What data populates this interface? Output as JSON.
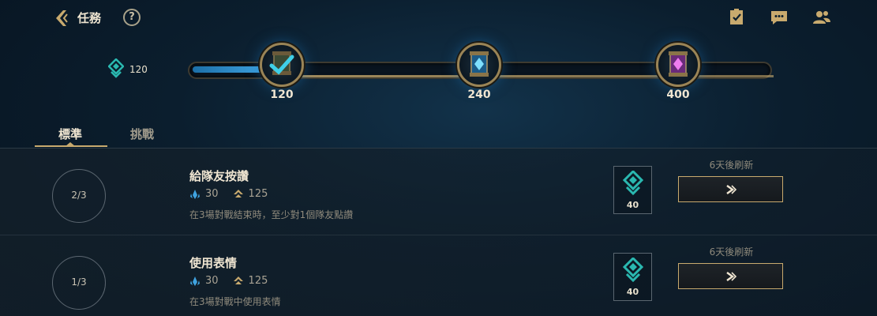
{
  "header": {
    "title": "任務",
    "help_symbol": "?",
    "icons": [
      "back-chevron-icon",
      "help-icon",
      "checklist-icon",
      "chat-icon",
      "friends-icon"
    ]
  },
  "progress": {
    "currency_amount": "120",
    "fill_fraction": 0.13,
    "milestones": [
      {
        "value": "120",
        "state": "claimed"
      },
      {
        "value": "240",
        "state": "locked"
      },
      {
        "value": "400",
        "state": "locked"
      }
    ]
  },
  "tabs": {
    "standard": "標準",
    "challenge": "挑戰",
    "active": "standard"
  },
  "missions": [
    {
      "progress": "2/3",
      "title": "給隊友按讚",
      "reward_a": "30",
      "reward_b": "125",
      "description": "在3場對戰結束時，至少對1個隊友點讚",
      "token_reward": "40",
      "refresh": "6天後刷新"
    },
    {
      "progress": "1/3",
      "title": "使用表情",
      "reward_a": "30",
      "reward_b": "125",
      "description": "在3場對戰中使用表情",
      "token_reward": "40",
      "refresh": "6天後刷新"
    }
  ],
  "colors": {
    "gold": "#c8aa6e",
    "teal": "#2ab8b0",
    "blue_fill": "#3fa3e0",
    "text": "#f0e6d2"
  }
}
